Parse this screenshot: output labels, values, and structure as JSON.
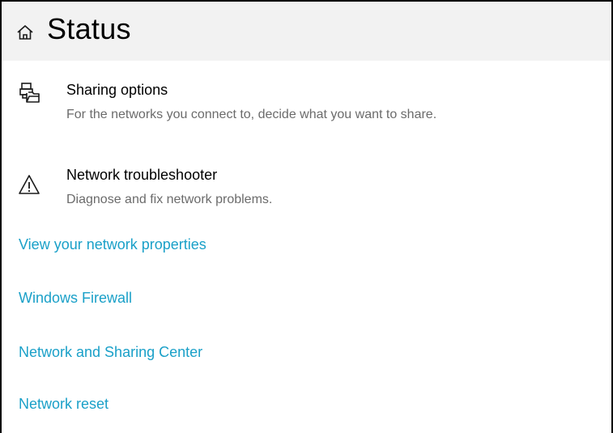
{
  "header": {
    "title": "Status",
    "icon": "home-icon"
  },
  "options": [
    {
      "icon": "sharing-options-icon",
      "title": "Sharing options",
      "description": "For the networks you connect to, decide what you want to share."
    },
    {
      "icon": "warning-icon",
      "title": "Network troubleshooter",
      "description": "Diagnose and fix network problems."
    }
  ],
  "links": [
    "View your network properties",
    "Windows Firewall",
    "Network and Sharing Center",
    "Network reset"
  ],
  "colors": {
    "link": "#1aa0c8",
    "header_background": "#f2f2f2",
    "description": "#6b6b6b"
  }
}
